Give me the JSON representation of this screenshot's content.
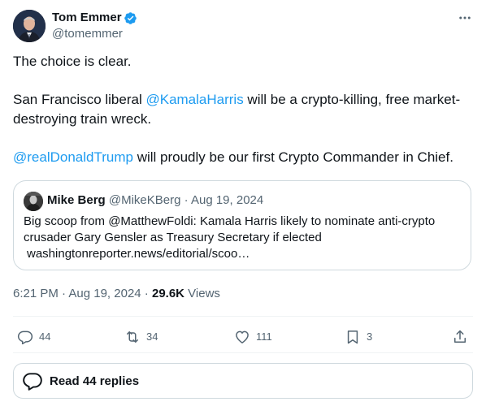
{
  "author": {
    "name": "Tom Emmer",
    "handle": "@tomemmer",
    "verified": true
  },
  "tweet": {
    "line1": "The choice is clear.",
    "para2_prefix": "San Francisco liberal ",
    "para2_mention": "@KamalaHarris",
    "para2_suffix": " will be a crypto-killing, free market-destroying train wreck.",
    "para3_mention": "@realDonaldTrump",
    "para3_suffix": " will proudly be our first Crypto Commander in Chief."
  },
  "quote": {
    "name": "Mike Berg",
    "handle": "@MikeKBerg",
    "sep": " · ",
    "date": "Aug 19, 2024",
    "line1": "Big scoop from @MatthewFoldi: Kamala Harris likely to nominate anti-crypto",
    "line2": "crusader Gary Gensler as Treasury Secretary if elected",
    "line3": "washingtonreporter.news/editorial/scoo…"
  },
  "meta": {
    "time": "6:21 PM",
    "sep": " · ",
    "date": "Aug 19, 2024",
    "views_count": "29.6K",
    "views_label": " Views"
  },
  "actions": {
    "replies": "44",
    "reposts": "34",
    "likes": "111",
    "bookmarks": "3"
  },
  "read_replies": "Read 44 replies",
  "colors": {
    "accent": "#1d9bf0",
    "text": "#0f1419",
    "muted": "#536471",
    "border": "#cfd9de"
  }
}
